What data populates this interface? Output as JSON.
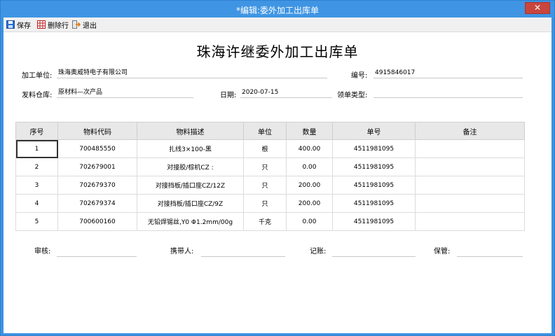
{
  "window": {
    "title": "*编辑:委外加工出库单",
    "close_label": "✕"
  },
  "toolbar": {
    "save": "保存",
    "delete_row": "删除行",
    "exit": "退出"
  },
  "doc": {
    "title": "珠海许继委外加工出库单",
    "unit_label": "加工单位:",
    "unit_value": "珠海奥威特电子有限公司",
    "number_label": "编号:",
    "number_value": "4915846017",
    "warehouse_label": "发料仓库:",
    "warehouse_value": "原材料—次产品",
    "date_label": "日期:",
    "date_value": "2020-07-15",
    "type_label": "领单类型:",
    "type_value": ""
  },
  "table": {
    "headers": [
      "序号",
      "物料代码",
      "物料描述",
      "单位",
      "数量",
      "单号",
      "备注"
    ],
    "rows": [
      [
        "1",
        "700485550",
        "扎线3×100-黑",
        "根",
        "400.00",
        "4511981095",
        ""
      ],
      [
        "2",
        "702679001",
        "对接胶/棕机CZ :",
        "只",
        "0.00",
        "4511981095",
        ""
      ],
      [
        "3",
        "702679370",
        "对接挡板/插口座CZ/12Z",
        "只",
        "200.00",
        "4511981095",
        ""
      ],
      [
        "4",
        "702679374",
        "对接挡板/插口座CZ/9Z",
        "只",
        "200.00",
        "4511981095",
        ""
      ],
      [
        "5",
        "700600160",
        "无铅焊锡丝,Y0 Φ1.2mm/00g",
        "千克",
        "0.00",
        "4511981095",
        ""
      ]
    ]
  },
  "footer": {
    "review": "审核:",
    "handler": "携带人:",
    "bookkeeping": "记账:",
    "keeper": "保管:"
  }
}
